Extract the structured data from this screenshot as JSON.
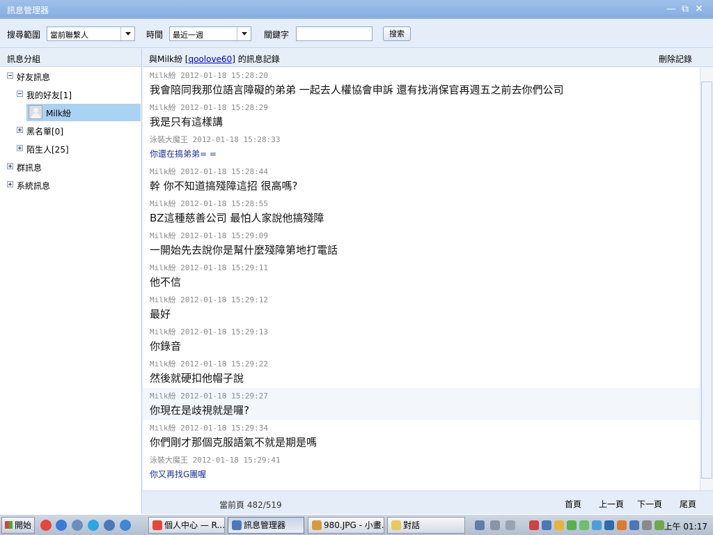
{
  "window": {
    "title": "訊息管理器",
    "minimize": "—",
    "restore": "⧉",
    "close": "✕"
  },
  "toolbar": {
    "scope_label": "搜尋範圍",
    "scope_value": "當前聯繫人",
    "time_label": "時間",
    "time_value": "最近一週",
    "keyword_label": "關鍵字",
    "keyword_value": "",
    "search_button": "搜索"
  },
  "sidebar": {
    "header": "訊息分組",
    "tree": {
      "friends_msgs": "好友訊息",
      "my_friends": "我的好友[1]",
      "contact": "Milk紛",
      "blacklist": "黑名單[0]",
      "strangers": "陌生人[25]",
      "group_msgs": "群訊息",
      "system_msgs": "系統訊息"
    }
  },
  "chat_header": {
    "prefix": "與Milk紛 [",
    "account": "qoolove60",
    "suffix": "] 的訊息記錄",
    "delete": "刪除記錄"
  },
  "messages": [
    {
      "sender": "Milk紛",
      "time": "2012-01-18 15:28:20",
      "text": "我會陪同我那位語言障礙的弟弟 一起去人權協會申訴 還有找消保官再週五之前去你們公司",
      "style": "normal"
    },
    {
      "sender": "Milk紛",
      "time": "2012-01-18 15:28:29",
      "text": "我是只有這樣講",
      "style": "normal"
    },
    {
      "sender": "泳裝大魔王",
      "time": "2012-01-18 15:28:33",
      "text": "你還在搞弟弟= =",
      "style": "blue"
    },
    {
      "sender": "Milk紛",
      "time": "2012-01-18 15:28:44",
      "text": "幹 你不知道搞殘障這招 很高嗎?",
      "style": "normal"
    },
    {
      "sender": "Milk紛",
      "time": "2012-01-18 15:28:55",
      "text": "BZ這種慈善公司 最怕人家說他搞殘障",
      "style": "normal"
    },
    {
      "sender": "Milk紛",
      "time": "2012-01-18 15:29:09",
      "text": "一開始先去說你是幫什麼殘障第地打電話",
      "style": "normal"
    },
    {
      "sender": "Milk紛",
      "time": "2012-01-18 15:29:11",
      "text": "他不信",
      "style": "normal"
    },
    {
      "sender": "Milk紛",
      "time": "2012-01-18 15:29:12",
      "text": "最好",
      "style": "normal"
    },
    {
      "sender": "Milk紛",
      "time": "2012-01-18 15:29:13",
      "text": "你錄音",
      "style": "normal"
    },
    {
      "sender": "Milk紛",
      "time": "2012-01-18 15:29:22",
      "text": "然後就硬扣他帽子說",
      "style": "normal"
    },
    {
      "sender": "Milk紛",
      "time": "2012-01-18 15:29:27",
      "text": "你現在是歧視就是囉?",
      "style": "normal"
    },
    {
      "sender": "Milk紛",
      "time": "2012-01-18 15:29:34",
      "text": "你們剛才那個克服語氣不就是期是嗎",
      "style": "normal"
    },
    {
      "sender": "泳裝大魔王",
      "time": "2012-01-18 15:29:41",
      "text": "你又再找G團喔",
      "style": "blue"
    }
  ],
  "footer": {
    "page_label": "當前頁 482/519",
    "first": "首頁",
    "prev": "上一頁",
    "next": "下一頁",
    "last": "尾頁"
  },
  "taskbar": {
    "start": "開始",
    "tasks": [
      "個人中心 — R...",
      "訊息管理器",
      "980.JPG - 小畫...",
      "對話"
    ],
    "clock": "上午 01:17"
  }
}
